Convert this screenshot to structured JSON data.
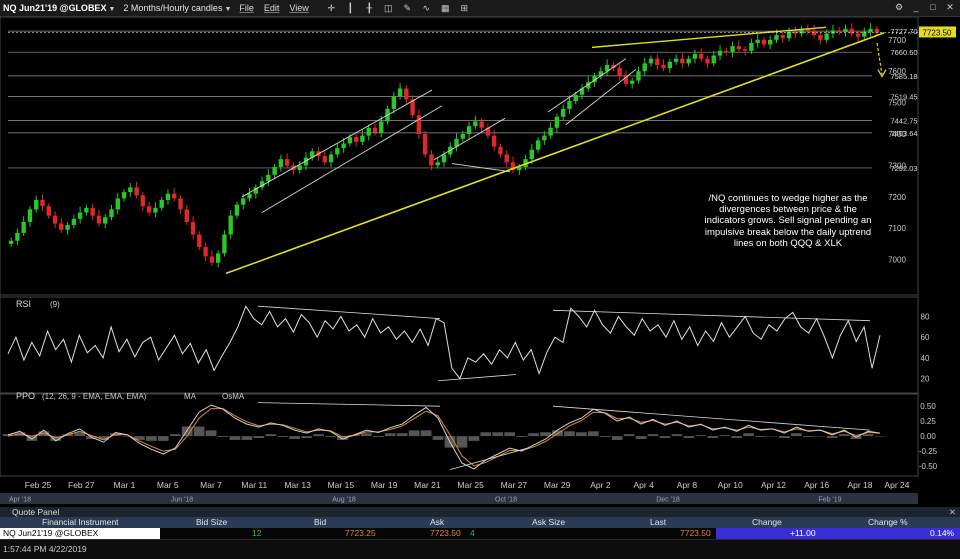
{
  "titlebar": {
    "symbol": "NQ Jun21'19 @GLOBEX",
    "period": "2 Months/Hourly candles",
    "menus": [
      "File",
      "Edit",
      "View"
    ]
  },
  "colors": {
    "up_candle": "#28c828",
    "down_candle": "#e02828",
    "trendline": "#e6dc1e",
    "channel": "#d8d8d8",
    "osc_line": "#e0e0e0",
    "ppo_line": "#d0d0d0",
    "ma_line": "#e08a2a",
    "hist": "#555555",
    "last_price_bg": "#e6dc1e",
    "quote_change_bg": "#3a2fd6"
  },
  "chart_data": [
    {
      "type": "line",
      "title": "NQ Jun21'19 @GLOBEX 2 Months/Hourly candles",
      "ylim": [
        6900,
        7760
      ],
      "y_ticks": [
        7000,
        7100,
        7200,
        7300,
        7400,
        7500,
        7600,
        7700
      ],
      "price_levels": [
        {
          "label": "7727.70",
          "value": 7727.7
        },
        {
          "label": "7660.60",
          "value": 7660.6
        },
        {
          "label": "7585.18",
          "value": 7585.18
        },
        {
          "label": "7519.45",
          "value": 7519.45
        },
        {
          "label": "7442.75",
          "value": 7442.75
        },
        {
          "label": "7403.64",
          "value": 7403.64
        },
        {
          "label": "7292.03",
          "value": 7292.03
        }
      ],
      "last_price": "7723.50",
      "series": [
        {
          "values": [
            7060,
            7085,
            7120,
            7160,
            7190,
            7170,
            7140,
            7115,
            7095,
            7110,
            7130,
            7150,
            7165,
            7140,
            7115,
            7135,
            7160,
            7195,
            7215,
            7230,
            7205,
            7170,
            7150,
            7165,
            7190,
            7210,
            7195,
            7160,
            7120,
            7080,
            7040,
            7010,
            6990,
            7020,
            7080,
            7140,
            7175,
            7195,
            7210,
            7230,
            7250,
            7270,
            7295,
            7320,
            7300,
            7285,
            7300,
            7325,
            7345,
            7330,
            7310,
            7335,
            7355,
            7370,
            7390,
            7375,
            7395,
            7420,
            7405,
            7440,
            7480,
            7520,
            7545,
            7510,
            7460,
            7400,
            7335,
            7300,
            7310,
            7335,
            7360,
            7385,
            7400,
            7425,
            7440,
            7420,
            7395,
            7360,
            7335,
            7310,
            7285,
            7295,
            7320,
            7350,
            7380,
            7395,
            7420,
            7455,
            7480,
            7505,
            7525,
            7545,
            7565,
            7585,
            7600,
            7620,
            7610,
            7585,
            7560,
            7570,
            7600,
            7625,
            7640,
            7620,
            7610,
            7630,
            7640,
            7625,
            7640,
            7655,
            7640,
            7625,
            7650,
            7665,
            7660,
            7680,
            7670,
            7665,
            7690,
            7700,
            7685,
            7700,
            7715,
            7705,
            7725,
            7720,
            7735,
            7730,
            7715,
            7700,
            7720,
            7730,
            7725,
            7735,
            7720,
            7710,
            7725,
            7735,
            7723
          ]
        }
      ],
      "trendlines": [
        {
          "x": [
            0.06,
            0.275,
            0.59
          ],
          "y": [
            6956,
            7380,
            7722
          ],
          "label": "daily uptrend"
        },
        {
          "x": [
            0.0,
            0.1
          ],
          "y": [
            0,
            0
          ]
        }
      ],
      "annotation": "/NQ continues to wedge higher as the divergences between price & the indicators grows. Sell signal pending an impulsive break below the daily uptrend lines on both QQQ & XLK"
    },
    {
      "type": "line",
      "title": "RSI (9)",
      "ylim": [
        10,
        95
      ],
      "y_ticks": [
        20,
        40,
        60,
        80
      ],
      "series": [
        {
          "name": "RSI",
          "values": [
            44,
            60,
            38,
            55,
            42,
            66,
            48,
            58,
            36,
            62,
            45,
            52,
            40,
            70,
            46,
            58,
            41,
            55,
            60,
            38,
            50,
            62,
            44,
            54,
            35,
            48,
            28,
            42,
            55,
            70,
            90,
            78,
            72,
            85,
            70,
            78,
            65,
            82,
            74,
            60,
            76,
            68,
            80,
            66,
            72,
            60,
            78,
            64,
            70,
            58,
            66,
            55,
            68,
            52,
            78,
            74,
            30,
            20,
            40,
            36,
            44,
            34,
            48,
            40,
            55,
            38,
            48,
            25,
            46,
            60,
            55,
            88,
            80,
            70,
            86,
            72,
            64,
            80,
            70,
            62,
            78,
            66,
            72,
            60,
            76,
            58,
            70,
            52,
            66,
            56,
            74,
            60,
            70,
            80,
            64,
            58,
            72,
            66,
            78,
            84,
            70,
            64,
            78,
            60,
            40,
            62,
            76,
            56,
            70,
            30,
            62
          ]
        }
      ]
    },
    {
      "type": "line",
      "title": "PPO (12, 26, 9 - EMA, EMA, EMA)",
      "ylim": [
        -0.6,
        0.62
      ],
      "y_ticks": [
        -0.5,
        -0.25,
        0.0,
        0.25,
        0.5
      ],
      "series": [
        {
          "name": "PPO",
          "values": [
            0.02,
            0.08,
            -0.05,
            0.1,
            -0.08,
            0.04,
            0.12,
            -0.02,
            -0.1,
            0.06,
            0.02,
            -0.12,
            -0.22,
            -0.3,
            -0.2,
            0.1,
            0.4,
            0.52,
            0.45,
            0.3,
            0.2,
            0.15,
            0.22,
            0.18,
            0.1,
            0.05,
            0.12,
            0.08,
            -0.05,
            0.02,
            0.1,
            0.06,
            0.14,
            0.2,
            0.35,
            0.48,
            0.3,
            -0.1,
            -0.45,
            -0.55,
            -0.4,
            -0.3,
            -0.2,
            -0.25,
            -0.15,
            -0.05,
            0.1,
            0.22,
            0.3,
            0.45,
            0.38,
            0.25,
            0.32,
            0.2,
            0.28,
            0.18,
            0.25,
            0.15,
            0.2,
            0.1,
            0.15,
            0.08,
            0.18,
            0.1,
            0.12,
            0.05,
            0.15,
            0.08,
            0.1,
            0.02,
            0.1,
            -0.02,
            0.08,
            0.05
          ]
        },
        {
          "name": "MA",
          "values": [
            0.0,
            0.04,
            0.0,
            0.05,
            -0.03,
            0.02,
            0.08,
            0.01,
            -0.06,
            0.03,
            0.02,
            -0.08,
            -0.17,
            -0.25,
            -0.22,
            0.0,
            0.3,
            0.46,
            0.46,
            0.34,
            0.24,
            0.17,
            0.2,
            0.19,
            0.13,
            0.07,
            0.1,
            0.09,
            -0.01,
            0.01,
            0.07,
            0.07,
            0.11,
            0.17,
            0.29,
            0.42,
            0.34,
            0.02,
            -0.33,
            -0.5,
            -0.44,
            -0.34,
            -0.24,
            -0.24,
            -0.18,
            -0.09,
            0.04,
            0.17,
            0.26,
            0.4,
            0.39,
            0.29,
            0.3,
            0.23,
            0.26,
            0.2,
            0.23,
            0.17,
            0.19,
            0.12,
            0.14,
            0.1,
            0.15,
            0.11,
            0.12,
            0.07,
            0.12,
            0.09,
            0.1,
            0.04,
            0.08,
            0.01,
            0.06,
            0.05
          ]
        }
      ]
    }
  ],
  "rsi_header": {
    "name": "RSI",
    "params": "(9)"
  },
  "ppo_header": {
    "name": "PPO",
    "params": "(12, 26, 9 - EMA, EMA, EMA)",
    "ma": "MA",
    "osma": "OsMA"
  },
  "xaxis": {
    "date_labels": [
      "Feb 25",
      "Feb 27",
      "Mar 1",
      "Mar 5",
      "Mar 7",
      "Mar 11",
      "Mar 13",
      "Mar 15",
      "Mar 19",
      "Mar 21",
      "Mar 25",
      "Mar 27",
      "Mar 29",
      "Apr 2",
      "Apr 4",
      "Apr 8",
      "Apr 10",
      "Apr 12",
      "Apr 16",
      "Apr 18",
      "Apr 24"
    ],
    "overview_labels": [
      "Apr '18",
      "Jun '18",
      "Aug '18",
      "Oct '18",
      "Dec '18",
      "Feb '19"
    ]
  },
  "quote_panel": {
    "title": "Quote Panel",
    "columns": [
      "Financial Instrument",
      "Bid Size",
      "Bid",
      "Ask",
      "Ask Size",
      "Last",
      "Change",
      "Change %"
    ],
    "row": {
      "instrument": "NQ Jun21'19 @GLOBEX",
      "bid_size": "12",
      "bid": "7723.25",
      "ask": "7723.50",
      "ask_size": "4",
      "last": "7723.50",
      "change": "+11.00",
      "change_pct": "0.14%"
    }
  },
  "status": {
    "time": "1:57:44 PM 4/22/2019"
  }
}
